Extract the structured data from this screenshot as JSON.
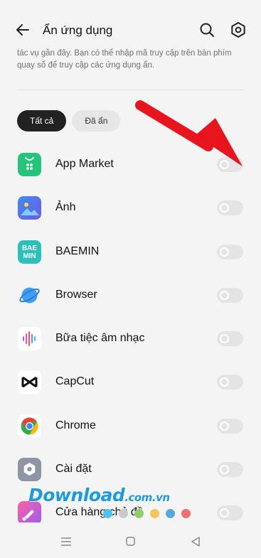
{
  "header": {
    "title": "Ẩn ứng dụng",
    "back_icon": "back-arrow-icon",
    "search_icon": "search-icon",
    "settings_icon": "gear-icon"
  },
  "description": "tác vụ gần đây. Bạn có thể nhập mã truy cập trên bàn phím quay số để truy cập các ứng dụng ẩn.",
  "tabs": [
    {
      "label": "Tất cả",
      "active": true
    },
    {
      "label": "Đã ẩn",
      "active": false
    }
  ],
  "apps": [
    {
      "name": "App Market",
      "hidden": false
    },
    {
      "name": "Ảnh",
      "hidden": false
    },
    {
      "name": "BAEMIN",
      "hidden": false
    },
    {
      "name": "Browser",
      "hidden": false
    },
    {
      "name": "Bữa tiệc âm nhạc",
      "hidden": false
    },
    {
      "name": "CapCut",
      "hidden": false
    },
    {
      "name": "Chrome",
      "hidden": false
    },
    {
      "name": "Cài đặt",
      "hidden": false
    },
    {
      "name": "Cửa hàng chủ đề",
      "hidden": false
    }
  ],
  "baemin_icon_text": [
    "BAE",
    "MIN"
  ],
  "watermark": {
    "main": "Download",
    "suffix": ".com.vn"
  },
  "watermark_dot_colors": [
    "#4ec3ef",
    "#c9c9c9",
    "#8fd06b",
    "#f6c45a",
    "#5aa7de",
    "#f06f6f"
  ],
  "navbar": {
    "menu_icon": "menu-icon",
    "home_icon": "home-icon",
    "back_icon": "back-triangle-icon"
  },
  "colors": {
    "annotation_arrow": "#e8141e",
    "background": "#f4f4f4",
    "active_tab": "#222222"
  }
}
